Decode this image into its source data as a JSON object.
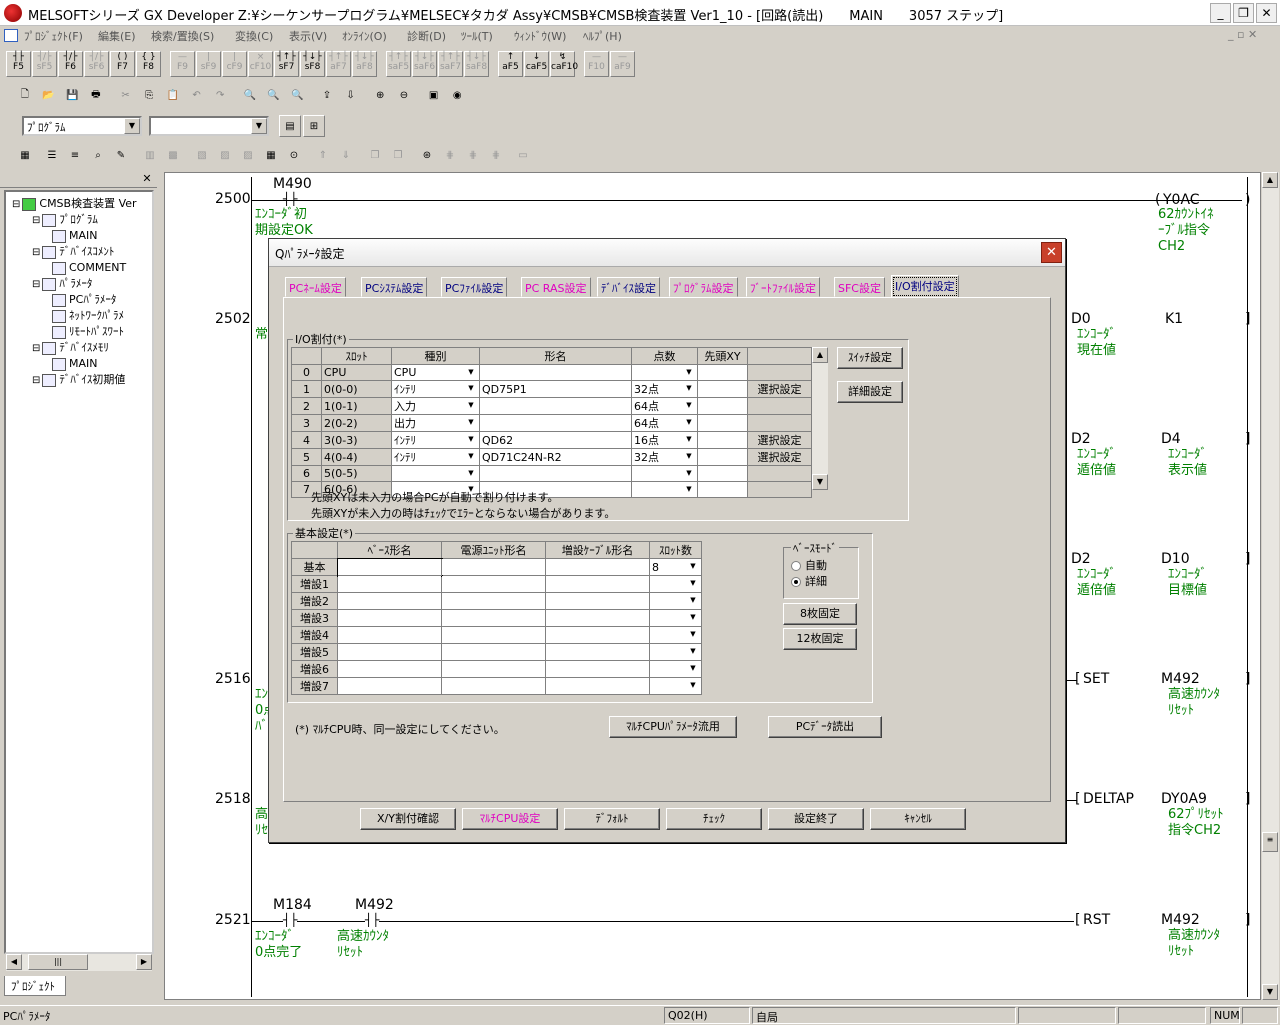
{
  "window": {
    "title": "MELSOFTシリーズ GX Developer Z:¥シーケンサープログラム¥MELSEC¥タカダ Assy¥CMSB¥CMSB検査装置 Ver1_10 - [回路(読出)　　MAIN　　3057 ステップ]"
  },
  "menu": [
    "ﾌﾟﾛｼﾞｪｸﾄ(F)",
    "編集(E)",
    "検索/置換(S)",
    "変換(C)",
    "表示(V)",
    "ｵﾝﾗｲﾝ(O)",
    "診断(D)",
    "ﾂｰﾙ(T)",
    "ｳｨﾝﾄﾞｳ(W)",
    "ﾍﾙﾌﾟ(H)"
  ],
  "fkeys": [
    {
      "sym": "┤├",
      "key": "F5",
      "enabled": true
    },
    {
      "sym": "┤/├",
      "key": "sF5",
      "enabled": false
    },
    {
      "sym": "┤/├",
      "key": "F6",
      "enabled": true
    },
    {
      "sym": "┤/├",
      "key": "sF6",
      "enabled": false
    },
    {
      "sym": "( )",
      "key": "F7",
      "enabled": true
    },
    {
      "sym": "{ }",
      "key": "F8",
      "enabled": true
    },
    {
      "sym": "—",
      "key": "F9",
      "enabled": false
    },
    {
      "sym": "|",
      "key": "sF9",
      "enabled": false
    },
    {
      "sym": "|",
      "key": "cF9",
      "enabled": false
    },
    {
      "sym": "×",
      "key": "cF10",
      "enabled": false
    },
    {
      "sym": "┤↑├",
      "key": "sF7",
      "enabled": true
    },
    {
      "sym": "┤↓├",
      "key": "sF8",
      "enabled": true
    },
    {
      "sym": "┤↑├",
      "key": "aF7",
      "enabled": false
    },
    {
      "sym": "┤↓├",
      "key": "aF8",
      "enabled": false
    },
    {
      "sym": "┤↑├",
      "key": "saF5",
      "enabled": false
    },
    {
      "sym": "┤↓├",
      "key": "saF6",
      "enabled": false
    },
    {
      "sym": "┤↑├",
      "key": "saF7",
      "enabled": false
    },
    {
      "sym": "┤↓├",
      "key": "saF8",
      "enabled": false
    },
    {
      "sym": "↑",
      "key": "aF5",
      "enabled": true
    },
    {
      "sym": "↓",
      "key": "caF5",
      "enabled": true
    },
    {
      "sym": "↯",
      "key": "caF10",
      "enabled": true
    },
    {
      "sym": "—",
      "key": "F10",
      "enabled": false
    },
    {
      "sym": "—",
      "key": "aF9",
      "enabled": false
    }
  ],
  "combo1": "ﾌﾟﾛｸﾞﾗﾑ",
  "combo2": "",
  "tree": [
    {
      "label": "CMSB検査装置 Ver",
      "level": 0
    },
    {
      "label": "ﾌﾟﾛｸﾞﾗﾑ",
      "level": 1
    },
    {
      "label": "MAIN",
      "level": 2
    },
    {
      "label": "ﾃﾞﾊﾞｲｽｺﾒﾝﾄ",
      "level": 1
    },
    {
      "label": "COMMENT",
      "level": 2
    },
    {
      "label": "ﾊﾟﾗﾒｰﾀ",
      "level": 1
    },
    {
      "label": "PCﾊﾟﾗﾒｰﾀ",
      "level": 2
    },
    {
      "label": "ﾈｯﾄﾜｰｸﾊﾟﾗﾒ",
      "level": 2
    },
    {
      "label": "ﾘﾓｰﾄﾊﾟｽﾜｰﾄ",
      "level": 2
    },
    {
      "label": "ﾃﾞﾊﾞｲｽﾒﾓﾘ",
      "level": 1
    },
    {
      "label": "MAIN",
      "level": 2
    },
    {
      "label": "ﾃﾞﾊﾞｲｽ初期値",
      "level": 1
    }
  ],
  "project_tab": "ﾌﾟﾛｼﾞｪｸﾄ",
  "ladder": {
    "r2500": {
      "step": "2500",
      "contact": "M490",
      "c1": "ｴﾝｺｰﾀﾞ初",
      "c2": "期設定OK",
      "coil": "Y0AC",
      "d1": "62ｶｳﾝﾄｲﾈ",
      "d2": "ｰﾌﾞﾙ指令",
      "d3": "CH2"
    },
    "r2502": {
      "step": "2502",
      "cm": "常",
      "o1": "D0",
      "o1c1": "ｴﾝｺｰﾀﾞ",
      "o1c2": "現在値",
      "o2": "K1"
    },
    "r2508": {
      "o1": "D2",
      "o1c1": "ｴﾝｺｰﾀﾞ",
      "o1c2": "遁倍値",
      "o2": "D4",
      "o2c1": "ｴﾝｺｰﾀﾞ",
      "o2c2": "表示値"
    },
    "r2512": {
      "o1": "D2",
      "o1c1": "ｴﾝｺｰﾀﾞ",
      "o1c2": "遁倍値",
      "o2": "D10",
      "o2c1": "ｴﾝｺｰﾀﾞ",
      "o2c2": "目標値"
    },
    "r2516": {
      "step": "2516",
      "cm1": "ｴﾝ",
      "cm2": "0点",
      "cm3": "ﾊﾞ",
      "op": "SET",
      "coil": "M492",
      "d1": "高速ｶｳﾝﾀ",
      "d2": "ﾘｾｯﾄ"
    },
    "r2518": {
      "step": "2518",
      "cm1": "高",
      "cm2": "ﾘｾ",
      "op": "DELTAP",
      "coil": "DY0A9",
      "d1": "62ﾌﾟﾘｾｯﾄ",
      "d2": "指令CH2"
    },
    "r2521": {
      "step": "2521",
      "c_a": "M184",
      "ca1": "ｴﾝｺｰﾀﾞ",
      "ca2": "0点完了",
      "c_b": "M492",
      "cb1": "高速ｶｳﾝﾀ",
      "cb2": "ﾘｾｯﾄ",
      "op": "RST",
      "coil": "M492",
      "d1": "高速ｶｳﾝﾀ",
      "d2": "ﾘｾｯﾄ"
    }
  },
  "dialog": {
    "title": "Qﾊﾟﾗﾒｰﾀ設定",
    "tabs": [
      {
        "label": "PCﾈｰﾑ設定",
        "color": "pink"
      },
      {
        "label": "PCｼｽﾃﾑ設定",
        "color": "blu"
      },
      {
        "label": "PCﾌｧｲﾙ設定",
        "color": "blu"
      },
      {
        "label": "PC RAS設定",
        "color": "pink"
      },
      {
        "label": "ﾃﾞﾊﾞｲｽ設定",
        "color": "blu"
      },
      {
        "label": "ﾌﾟﾛｸﾞﾗﾑ設定",
        "color": "pink"
      },
      {
        "label": "ﾌﾞｰﾄﾌｧｲﾙ設定",
        "color": "pink"
      },
      {
        "label": "SFC設定",
        "color": "pink"
      },
      {
        "label": "I/O割付設定",
        "color": "blu",
        "active": true
      }
    ],
    "io_group_label": "I/O割付(*)",
    "io_headers": [
      "",
      "ｽﾛｯﾄ",
      "種別",
      "形名",
      "点数",
      "先頭XY",
      ""
    ],
    "io_rows": [
      {
        "no": "0",
        "slot": "CPU",
        "type": "CPU",
        "model": "",
        "points": "",
        "xy": "",
        "btn": ""
      },
      {
        "no": "1",
        "slot": "0(0-0)",
        "type": "ｲﾝﾃﾘ",
        "model": "QD75P1",
        "points": "32点",
        "xy": "",
        "btn": "選択設定"
      },
      {
        "no": "2",
        "slot": "1(0-1)",
        "type": "入力",
        "model": "",
        "points": "64点",
        "xy": "",
        "btn": ""
      },
      {
        "no": "3",
        "slot": "2(0-2)",
        "type": "出力",
        "model": "",
        "points": "64点",
        "xy": "",
        "btn": ""
      },
      {
        "no": "4",
        "slot": "3(0-3)",
        "type": "ｲﾝﾃﾘ",
        "model": "QD62",
        "points": "16点",
        "xy": "",
        "btn": "選択設定"
      },
      {
        "no": "5",
        "slot": "4(0-4)",
        "type": "ｲﾝﾃﾘ",
        "model": "QD71C24N-R2",
        "points": "32点",
        "xy": "",
        "btn": "選択設定"
      },
      {
        "no": "6",
        "slot": "5(0-5)",
        "type": "",
        "model": "",
        "points": "",
        "xy": "",
        "btn": ""
      },
      {
        "no": "7",
        "slot": "6(0-6)",
        "type": "",
        "model": "",
        "points": "",
        "xy": "",
        "btn": ""
      }
    ],
    "switch_btn": "ｽｲｯﾁ設定",
    "detail_btn": "詳細設定",
    "note1": "先頭XYは未入力の場合PCが自動で割り付けます。",
    "note2": "先頭XYが未入力の時はﾁｪｯｸでｴﾗｰとならない場合があります。",
    "base_group_label": "基本設定(*)",
    "base_headers": [
      "",
      "ﾍﾞｰｽ形名",
      "電源ﾕﾆｯﾄ形名",
      "増設ｹｰﾌﾞﾙ形名",
      "ｽﾛｯﾄ数"
    ],
    "base_rows": [
      {
        "name": "基本",
        "slots": "8"
      },
      {
        "name": "増設1",
        "slots": ""
      },
      {
        "name": "増設2",
        "slots": ""
      },
      {
        "name": "増設3",
        "slots": ""
      },
      {
        "name": "増設4",
        "slots": ""
      },
      {
        "name": "増設5",
        "slots": ""
      },
      {
        "name": "増設6",
        "slots": ""
      },
      {
        "name": "増設7",
        "slots": ""
      }
    ],
    "base_mode_label": "ﾍﾞｰｽﾓｰﾄﾞ",
    "mode_auto": "自動",
    "mode_detail": "詳細",
    "fix8_btn": "8枚固定",
    "fix12_btn": "12枚固定",
    "multi_note": "(*) ﾏﾙﾁCPU時、同一設定にしてください。",
    "multi_param_btn": "ﾏﾙﾁCPUﾊﾟﾗﾒｰﾀ流用",
    "pc_read_btn": "PCﾃﾞｰﾀ読出",
    "bottom_buttons": [
      {
        "label": "X/Y割付確認",
        "color": ""
      },
      {
        "label": "ﾏﾙﾁCPU設定",
        "color": "pink"
      },
      {
        "label": "ﾃﾞﾌｫﾙﾄ",
        "color": ""
      },
      {
        "label": "ﾁｪｯｸ",
        "color": ""
      },
      {
        "label": "設定終了",
        "color": ""
      },
      {
        "label": "ｷｬﾝｾﾙ",
        "color": ""
      }
    ]
  },
  "status": {
    "left": "PCﾊﾟﾗﾒｰﾀ",
    "cpu": "Q02(H)",
    "station": "自局",
    "num": "NUM"
  }
}
